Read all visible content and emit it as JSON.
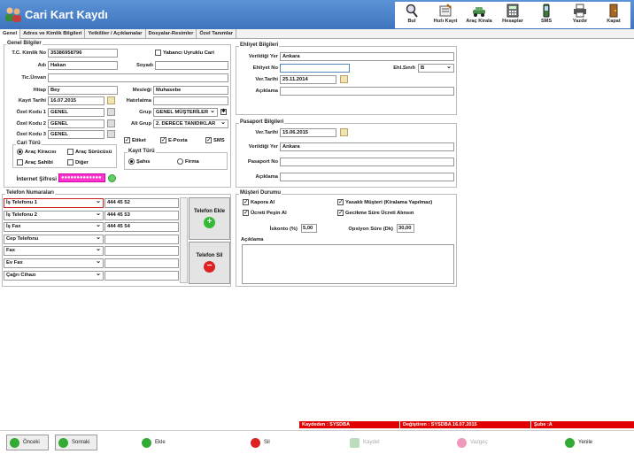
{
  "window": {
    "title": "Cari Kart Kaydı"
  },
  "toolbar": [
    {
      "label": "Bul",
      "icon": "magnifier-icon"
    },
    {
      "label": "Hızlı Kayıt",
      "icon": "notebook-icon"
    },
    {
      "label": "Araç Kirala",
      "icon": "car-icon"
    },
    {
      "label": "Hesaplar",
      "icon": "calculator-icon"
    },
    {
      "label": "SMS",
      "icon": "phone-icon"
    },
    {
      "label": "Yazdır",
      "icon": "printer-icon"
    },
    {
      "label": "Kapat",
      "icon": "door-icon"
    }
  ],
  "tabs": [
    "Genel",
    "Adres ve Kimlik Bilgileri",
    "Yetkililer / Açıklamalar",
    "Dosyalar-Resimler",
    "Özel Tanımlar"
  ],
  "genel": {
    "title": "Genel Bilgiler",
    "tc_label": "T.C. Kimlik No",
    "tc": "35386958796",
    "yabanci_label": "Yabancı Uyruklu Cari",
    "ad_label": "Adı",
    "ad": "Hakan",
    "soyadi_label": "Soyadı",
    "soyadi": "",
    "unvan_label": "Tic.Ünvan",
    "unvan": "",
    "hitap_label": "Hitap",
    "hitap": "Bey",
    "meslegi_label": "Mesleği",
    "meslegi": "Muhasebe",
    "kayit_label": "Kayıt Tarihi",
    "kayit": "16.07.2015",
    "hatirlatma_label": "Hatırlatma",
    "hatirlatma": "",
    "ozel1_label": "Özel Kodu 1",
    "ozel1": "GENEL",
    "grup_label": "Grup",
    "grup": "GENEL MÜŞTERİLER",
    "ozel2_label": "Özel Kodu 2",
    "ozel2": "GENEL",
    "altgrup_label": "Alt Grup",
    "altgrup": "2. DERECE TANIDIKLAR",
    "ozel3_label": "Özel Kodu 3",
    "ozel3": "GENEL",
    "cari_turu": "Cari Türü",
    "r_kiraci": "Araç Kiracısı",
    "r_surucu": "Araç Sürücüsü",
    "r_sahibi": "Araç Sahibi",
    "r_diger": "Diğer",
    "etiket": "Etiket",
    "eposta": "E-Posta",
    "sms": "SMS",
    "kayit_turu": "Kayıt Türü",
    "sahis": "Şahıs",
    "firma": "Firma",
    "sifre_label": "İnternet Şifresi",
    "sifre": "●●●●●●●●●●●●●"
  },
  "ehliyet": {
    "title": "Ehliyet Bilgileri",
    "verildigi_label": "Verildiği Yer",
    "verildigi": "Ankara",
    "no_label": "Ehliyet No",
    "no": "",
    "sinif_label": "Ehl.Sınıfı",
    "sinif": "B",
    "tarih_label": "Ver.Tarihi",
    "tarih": "25.11.2014",
    "aciklama_label": "Açıklama",
    "aciklama": ""
  },
  "pasaport": {
    "title": "Pasaport Bilgileri",
    "tarih_label": "Ver.Tarihi",
    "tarih": "15.06.2015",
    "verildigi_label": "Verildiği Yer",
    "verildigi": "Ankara",
    "no_label": "Pasaport No",
    "no": "",
    "aciklama_label": "Açıklama",
    "aciklama": ""
  },
  "telefon": {
    "title": "Telefon Numaraları",
    "rows": [
      {
        "type": "İş Telefonu 1",
        "number": "444 45 52"
      },
      {
        "type": "İş Telefonu 2",
        "number": "444 45 53"
      },
      {
        "type": "İş Fax",
        "number": "444 45 54"
      },
      {
        "type": "Cep Telefonu",
        "number": ""
      },
      {
        "type": "Fax",
        "number": ""
      },
      {
        "type": "Ev Fax",
        "number": ""
      },
      {
        "type": "Çağrı Cihazı",
        "number": ""
      }
    ],
    "ekle": "Telefon Ekle",
    "sil": "Telefon Sil"
  },
  "musteri": {
    "title": "Müşteri Durumu",
    "kapora": "Kapora Al",
    "yasakli": "Yasaklı Müşteri (Kiralama Yapılmaz)",
    "pesin": "Ücreti Peşin Al",
    "gecikme": "Gecikme Süre Ücreti Alınsın",
    "iskonto_label": "İskonto (%)",
    "iskonto": "5,00",
    "opsiyon_label": "Opsiyon Süre (Dk)",
    "opsiyon": "30,00",
    "aciklama_label": "Açıklama"
  },
  "status": {
    "kaydeden": "Kaydeden : SYSDBA",
    "degistiren": "Değiştiren : SYSDBA  16.07.2015",
    "sube": "Şube :A"
  },
  "footer": {
    "onceki": "Önceki",
    "sonraki": "Sonraki",
    "ekle": "Ekle",
    "sil": "Sil",
    "kaydet": "Kaydet",
    "vazgec": "Vazgeç",
    "yenile": "Yenile"
  },
  "colors": {
    "header": "#4a82c8",
    "status": "#e00000"
  }
}
